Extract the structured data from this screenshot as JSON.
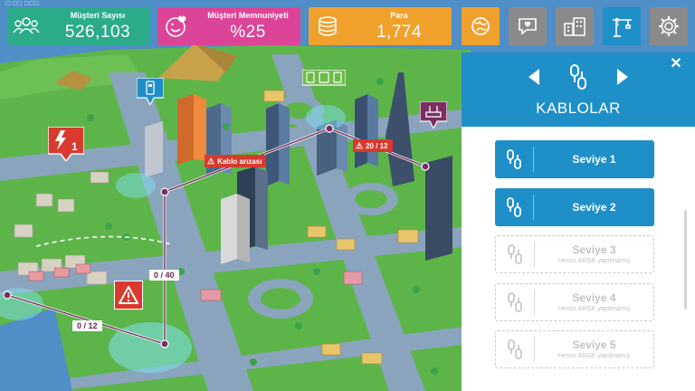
{
  "stats": {
    "customers": {
      "label": "Müşteri Sayısı",
      "value": "526,103",
      "icon": "people-icon"
    },
    "satisfaction": {
      "label": "Müşteri Memnuniyeti",
      "value": "%25",
      "icon": "smiley-heart-icon"
    },
    "money": {
      "label": "Para",
      "value": "1,774",
      "icon": "coins-icon"
    }
  },
  "top_buttons": [
    "map-icon",
    "heart-chat-icon",
    "buildings-icon",
    "crane-icon",
    "gear-icon"
  ],
  "panel": {
    "title": "KABLOLAR",
    "close": "✕",
    "levels": [
      {
        "name": "Seviye 1",
        "sub": "",
        "state": "active"
      },
      {
        "name": "Seviye 2",
        "sub": "",
        "state": "active"
      },
      {
        "name": "Seviye 3",
        "sub": "Henüz ARGE yapılmamış",
        "state": "locked"
      },
      {
        "name": "Seviye 4",
        "sub": "Henüz ARGE yapılmamış",
        "state": "locked"
      },
      {
        "name": "Seviye 5",
        "sub": "Henüz ARGE yapılmamış",
        "state": "locked"
      }
    ]
  },
  "map": {
    "cable_fault": "Kablo arızası",
    "node_count_top": "20 / 12",
    "node_count_mid": "0 / 40",
    "node_count_low": "0 / 12",
    "fault_count": "1"
  },
  "colors": {
    "customers": "#2bab8a",
    "satisfaction": "#dc4597",
    "money": "#f0a12c",
    "panel_blue": "#1f8fc8",
    "alert_red": "#d83a2e"
  }
}
